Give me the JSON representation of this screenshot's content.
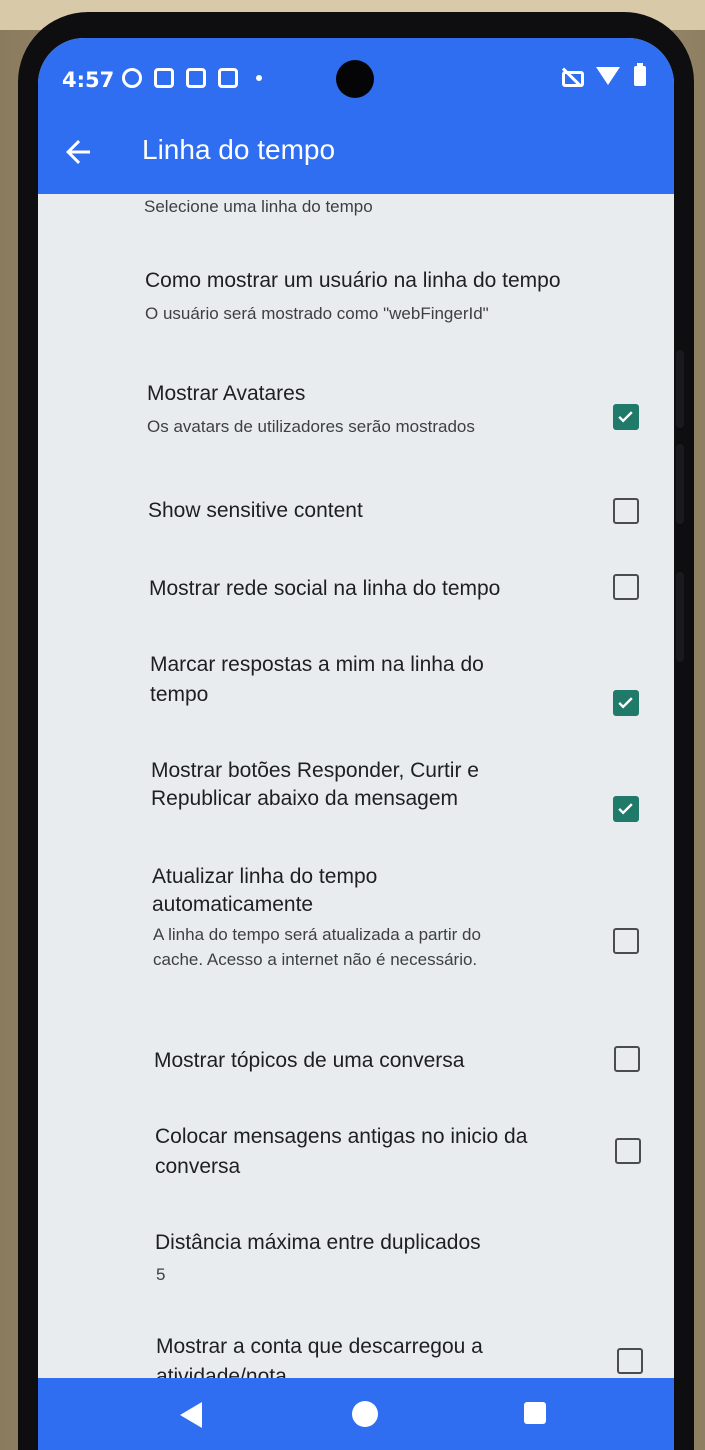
{
  "status_bar": {
    "time": "4:57",
    "left_icons": [
      "face-icon",
      "sim-icon",
      "bag-icon",
      "chat-icon",
      "dot-icon"
    ],
    "right_icons": [
      "mute-icon",
      "wifi-icon",
      "battery-icon"
    ]
  },
  "app_bar": {
    "back_icon": "arrow-left-icon",
    "title": "Linha do tempo"
  },
  "preferences": [
    {
      "title": "",
      "summary": "Selecione uma linha do tempo",
      "has_checkbox": false
    },
    {
      "title": "Como mostrar um usuário na linha do tempo",
      "summary": "O usuário será mostrado como \"webFingerId\"",
      "has_checkbox": false
    },
    {
      "title": "Mostrar Avatares",
      "summary": "Os avatars de utilizadores serão mostrados",
      "has_checkbox": true,
      "checked": true
    },
    {
      "title": "Show sensitive content",
      "summary": "",
      "has_checkbox": true,
      "checked": false
    },
    {
      "title": "Mostrar rede social na linha do tempo",
      "summary": "",
      "has_checkbox": true,
      "checked": false
    },
    {
      "title_line1": "Marcar respostas a mim na linha do",
      "title_line2": "tempo",
      "summary": "",
      "has_checkbox": true,
      "checked": true
    },
    {
      "title_line1": "Mostrar botões Responder, Curtir e",
      "title_line2": "Republicar abaixo da mensagem",
      "summary": "",
      "has_checkbox": true,
      "checked": true
    },
    {
      "title_line1": "Atualizar linha do tempo",
      "title_line2": "automaticamente",
      "summary_line1": "A linha do tempo será atualizada a partir do",
      "summary_line2": "cache. Acesso a internet não é necessário.",
      "has_checkbox": true,
      "checked": false
    },
    {
      "title": "Mostrar tópicos de uma conversa",
      "summary": "",
      "has_checkbox": true,
      "checked": false
    },
    {
      "title_line1": "Colocar mensagens antigas no inicio da",
      "title_line2": "conversa",
      "summary": "",
      "has_checkbox": true,
      "checked": false
    },
    {
      "title": "Distância máxima entre duplicados",
      "summary": "5",
      "has_checkbox": false
    },
    {
      "title_line1": "Mostrar a conta que descarregou a",
      "title_line2": "atividade/nota",
      "summary": "",
      "has_checkbox": true,
      "checked": false
    }
  ],
  "nav_bar": {
    "icons": [
      "nav-back-icon",
      "nav-home-icon",
      "nav-recents-icon"
    ]
  },
  "colors": {
    "primary": "#2f6ef0",
    "checkbox_checked": "#1f7a6a",
    "background": "#e9ecef"
  }
}
